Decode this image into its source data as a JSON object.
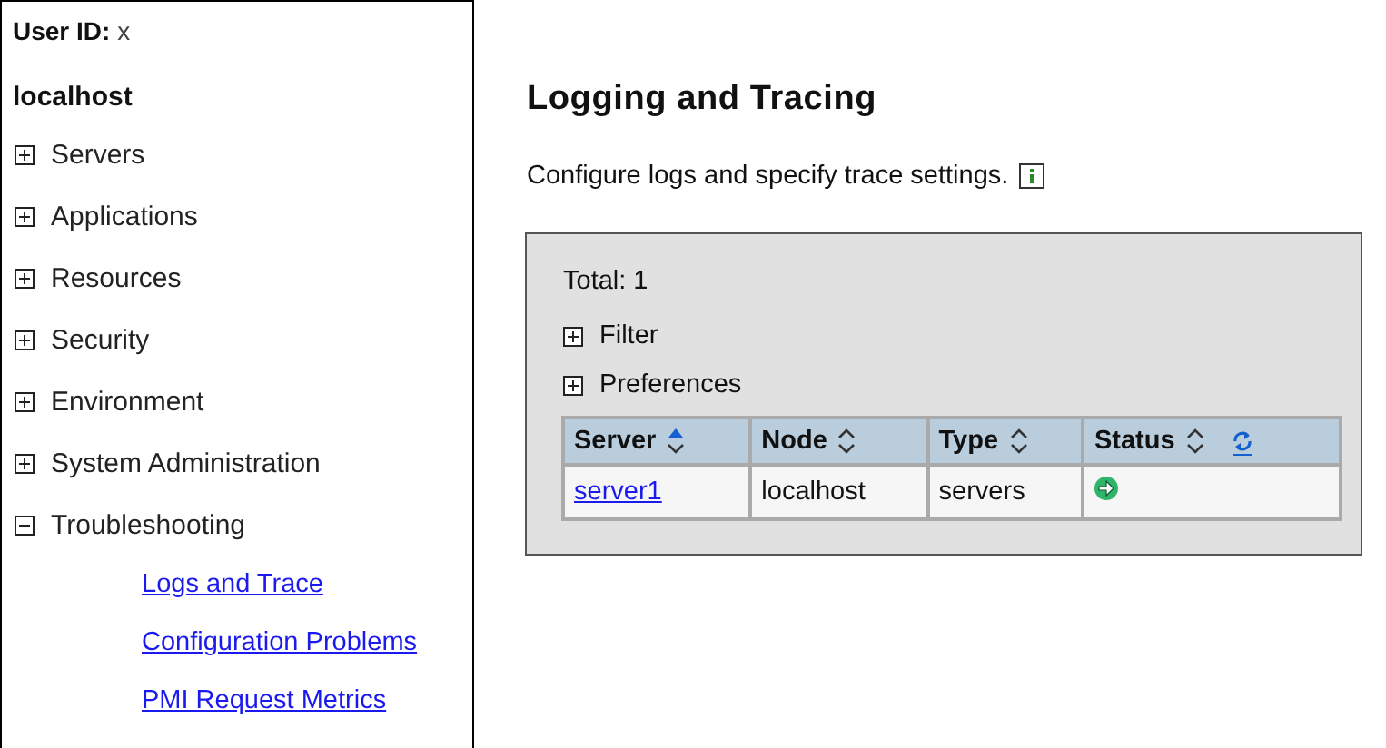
{
  "sidebar": {
    "user_label": "User ID:",
    "user_value": "x",
    "host": "localhost",
    "items": [
      {
        "label": "Servers",
        "expanded": false
      },
      {
        "label": "Applications",
        "expanded": false
      },
      {
        "label": "Resources",
        "expanded": false
      },
      {
        "label": "Security",
        "expanded": false
      },
      {
        "label": "Environment",
        "expanded": false
      },
      {
        "label": "System Administration",
        "expanded": false
      },
      {
        "label": "Troubleshooting",
        "expanded": true,
        "children": [
          {
            "label": "Logs and Trace"
          },
          {
            "label": "Configuration Problems"
          },
          {
            "label": "PMI Request Metrics"
          }
        ]
      }
    ]
  },
  "main": {
    "title": "Logging and Tracing",
    "description": "Configure logs and specify trace settings.",
    "panel": {
      "total": "Total: 1",
      "toggles": [
        {
          "label": "Filter",
          "expanded": false
        },
        {
          "label": "Preferences",
          "expanded": false
        }
      ],
      "table": {
        "columns": [
          {
            "label": "Server",
            "sorted": true
          },
          {
            "label": "Node",
            "sorted": false
          },
          {
            "label": "Type",
            "sorted": false
          },
          {
            "label": "Status",
            "sorted": false
          }
        ],
        "rows": [
          {
            "server": "server1",
            "node": "localhost",
            "type": "servers",
            "status": {
              "kind": "started"
            }
          }
        ]
      }
    }
  }
}
